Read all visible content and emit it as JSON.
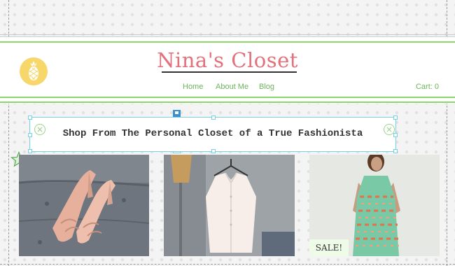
{
  "header": {
    "site_title": "Nina's Closet",
    "nav": [
      "Home",
      "About Me",
      "Blog"
    ],
    "cart_label": "Cart: 0"
  },
  "banner": {
    "text": "Shop From The Personal Closet of a True Fashionista"
  },
  "products": [
    {
      "image": "pink-sandals-photo"
    },
    {
      "image": "white-blouse-on-hanger-photo"
    },
    {
      "image": "woman-in-print-dress-photo",
      "tag": "SALE!"
    }
  ],
  "colors": {
    "title": "#e3707a",
    "nav": "#6bb55a",
    "accent_lines": "#8bd86a",
    "logo": "#f7d66a",
    "selection": "#76d2e6"
  }
}
